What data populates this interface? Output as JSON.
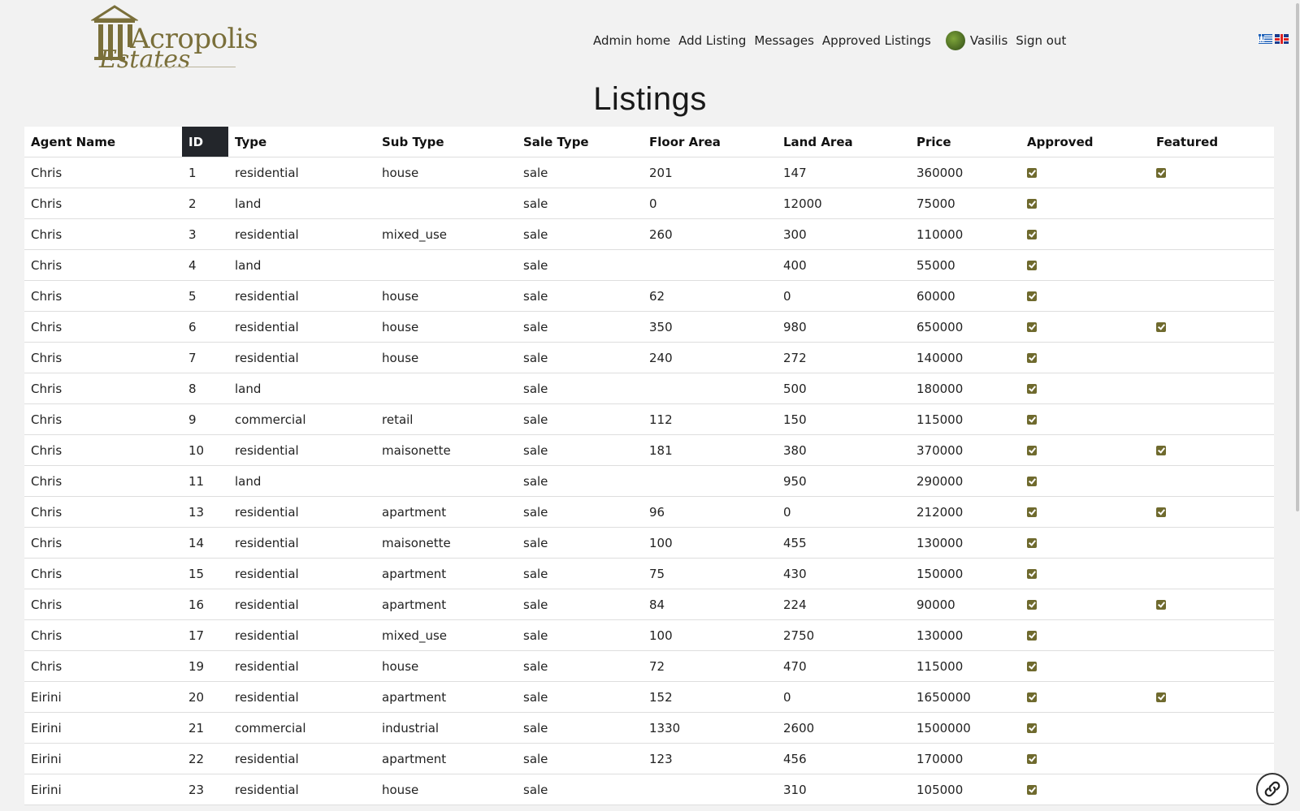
{
  "brand": {
    "line1": "Acropolis",
    "line2": "Estates",
    "color": "#7a6f3a"
  },
  "nav": {
    "items": [
      "Admin home",
      "Add Listing",
      "Messages",
      "Approved Listings"
    ],
    "user_name": "Vasilis",
    "sign_out": "Sign out"
  },
  "languages": [
    "greek-flag-icon",
    "uk-flag-icon"
  ],
  "page_title": "Listings",
  "table": {
    "columns": [
      "Agent Name",
      "ID",
      "Type",
      "Sub Type",
      "Sale Type",
      "Floor Area",
      "Land Area",
      "Price",
      "Approved",
      "Featured"
    ],
    "sorted_column": "ID",
    "rows": [
      {
        "agent": "Chris",
        "id": "1",
        "type": "residential",
        "sub_type": "house",
        "sale_type": "sale",
        "floor_area": "201",
        "land_area": "147",
        "price": "360000",
        "approved": true,
        "featured": true
      },
      {
        "agent": "Chris",
        "id": "2",
        "type": "land",
        "sub_type": "",
        "sale_type": "sale",
        "floor_area": "0",
        "land_area": "12000",
        "price": "75000",
        "approved": true,
        "featured": false
      },
      {
        "agent": "Chris",
        "id": "3",
        "type": "residential",
        "sub_type": "mixed_use",
        "sale_type": "sale",
        "floor_area": "260",
        "land_area": "300",
        "price": "110000",
        "approved": true,
        "featured": false
      },
      {
        "agent": "Chris",
        "id": "4",
        "type": "land",
        "sub_type": "",
        "sale_type": "sale",
        "floor_area": "",
        "land_area": "400",
        "price": "55000",
        "approved": true,
        "featured": false
      },
      {
        "agent": "Chris",
        "id": "5",
        "type": "residential",
        "sub_type": "house",
        "sale_type": "sale",
        "floor_area": "62",
        "land_area": "0",
        "price": "60000",
        "approved": true,
        "featured": false
      },
      {
        "agent": "Chris",
        "id": "6",
        "type": "residential",
        "sub_type": "house",
        "sale_type": "sale",
        "floor_area": "350",
        "land_area": "980",
        "price": "650000",
        "approved": true,
        "featured": true
      },
      {
        "agent": "Chris",
        "id": "7",
        "type": "residential",
        "sub_type": "house",
        "sale_type": "sale",
        "floor_area": "240",
        "land_area": "272",
        "price": "140000",
        "approved": true,
        "featured": false
      },
      {
        "agent": "Chris",
        "id": "8",
        "type": "land",
        "sub_type": "",
        "sale_type": "sale",
        "floor_area": "",
        "land_area": "500",
        "price": "180000",
        "approved": true,
        "featured": false
      },
      {
        "agent": "Chris",
        "id": "9",
        "type": "commercial",
        "sub_type": "retail",
        "sale_type": "sale",
        "floor_area": "112",
        "land_area": "150",
        "price": "115000",
        "approved": true,
        "featured": false
      },
      {
        "agent": "Chris",
        "id": "10",
        "type": "residential",
        "sub_type": "maisonette",
        "sale_type": "sale",
        "floor_area": "181",
        "land_area": "380",
        "price": "370000",
        "approved": true,
        "featured": true
      },
      {
        "agent": "Chris",
        "id": "11",
        "type": "land",
        "sub_type": "",
        "sale_type": "sale",
        "floor_area": "",
        "land_area": "950",
        "price": "290000",
        "approved": true,
        "featured": false
      },
      {
        "agent": "Chris",
        "id": "13",
        "type": "residential",
        "sub_type": "apartment",
        "sale_type": "sale",
        "floor_area": "96",
        "land_area": "0",
        "price": "212000",
        "approved": true,
        "featured": true
      },
      {
        "agent": "Chris",
        "id": "14",
        "type": "residential",
        "sub_type": "maisonette",
        "sale_type": "sale",
        "floor_area": "100",
        "land_area": "455",
        "price": "130000",
        "approved": true,
        "featured": false
      },
      {
        "agent": "Chris",
        "id": "15",
        "type": "residential",
        "sub_type": "apartment",
        "sale_type": "sale",
        "floor_area": "75",
        "land_area": "430",
        "price": "150000",
        "approved": true,
        "featured": false
      },
      {
        "agent": "Chris",
        "id": "16",
        "type": "residential",
        "sub_type": "apartment",
        "sale_type": "sale",
        "floor_area": "84",
        "land_area": "224",
        "price": "90000",
        "approved": true,
        "featured": true
      },
      {
        "agent": "Chris",
        "id": "17",
        "type": "residential",
        "sub_type": "mixed_use",
        "sale_type": "sale",
        "floor_area": "100",
        "land_area": "2750",
        "price": "130000",
        "approved": true,
        "featured": false
      },
      {
        "agent": "Chris",
        "id": "19",
        "type": "residential",
        "sub_type": "house",
        "sale_type": "sale",
        "floor_area": "72",
        "land_area": "470",
        "price": "115000",
        "approved": true,
        "featured": false
      },
      {
        "agent": "Eirini",
        "id": "20",
        "type": "residential",
        "sub_type": "apartment",
        "sale_type": "sale",
        "floor_area": "152",
        "land_area": "0",
        "price": "1650000",
        "approved": true,
        "featured": true
      },
      {
        "agent": "Eirini",
        "id": "21",
        "type": "commercial",
        "sub_type": "industrial",
        "sale_type": "sale",
        "floor_area": "1330",
        "land_area": "2600",
        "price": "1500000",
        "approved": true,
        "featured": false
      },
      {
        "agent": "Eirini",
        "id": "22",
        "type": "residential",
        "sub_type": "apartment",
        "sale_type": "sale",
        "floor_area": "123",
        "land_area": "456",
        "price": "170000",
        "approved": true,
        "featured": false
      },
      {
        "agent": "Eirini",
        "id": "23",
        "type": "residential",
        "sub_type": "house",
        "sale_type": "sale",
        "floor_area": "",
        "land_area": "310",
        "price": "105000",
        "approved": true,
        "featured": false
      }
    ]
  },
  "colors": {
    "checkbox": "#6f6a2e",
    "sorted_header_bg": "#23262b",
    "page_bg": "#f2f2f2"
  },
  "chat_button_icon": "chat-link-icon"
}
